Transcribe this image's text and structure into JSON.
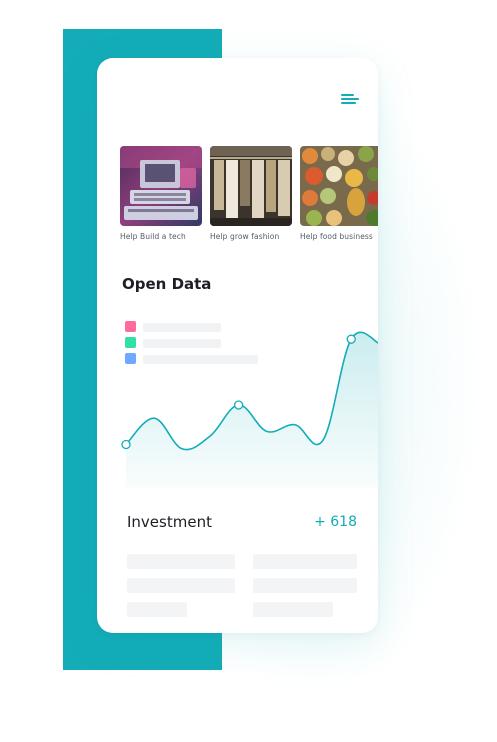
{
  "brand": {
    "accent": "#13acb7",
    "legend_colors": [
      "#ff6b9d",
      "#2fe0a7",
      "#6fa8ff"
    ]
  },
  "header": {
    "menu_icon": "hamburger-menu-icon"
  },
  "carousel": {
    "items": [
      {
        "label": "Help Build a tech",
        "image": "retro-computer-photo"
      },
      {
        "label": "Help grow fashion",
        "image": "clothing-rack-photo"
      },
      {
        "label": "Help food business",
        "image": "fruits-and-vegetables-photo"
      }
    ]
  },
  "open_data": {
    "title": "Open Data"
  },
  "chart_data": {
    "type": "area",
    "title": "",
    "xlabel": "",
    "ylabel": "",
    "grid": false,
    "series": [
      {
        "color": "#13acb7",
        "points": [
          {
            "x": 0,
            "y": 18
          },
          {
            "x": 1,
            "y": 30
          },
          {
            "x": 2,
            "y": 16
          },
          {
            "x": 3,
            "y": 22
          },
          {
            "x": 4,
            "y": 36
          },
          {
            "x": 5,
            "y": 24
          },
          {
            "x": 6,
            "y": 27
          },
          {
            "x": 7,
            "y": 20
          },
          {
            "x": 8,
            "y": 66
          },
          {
            "x": 9,
            "y": 64
          }
        ],
        "markers": [
          0,
          4,
          8
        ]
      }
    ]
  },
  "investment": {
    "title": "Investment",
    "value": "+ 618"
  }
}
